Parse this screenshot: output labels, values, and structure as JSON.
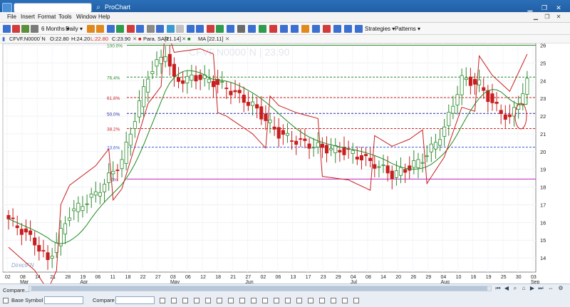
{
  "window": {
    "title": "ProChart",
    "search_value": ""
  },
  "menu": [
    "File",
    "Insert",
    "Format",
    "Tools",
    "Window",
    "Help"
  ],
  "toolbar": {
    "range": "6 Months",
    "interval": "Daily",
    "strategies": "Strategies",
    "patterns": "Patterns"
  },
  "quote": {
    "symbol": "CFVF.N0000`N",
    "open": "O:22.80",
    "high": "H:24.20",
    "low": "L:22.80",
    "close": "C:23.90"
  },
  "indicators": [
    {
      "label": "Para. SAR",
      "value": "[21.14]",
      "color": "#d42020"
    },
    {
      "label": "MA",
      "value": "[22.11]",
      "color": "#1e8a1e"
    }
  ],
  "watermark": "CFVF.N0000`N | 23.90",
  "brand_logo": "DirectFN",
  "fib_levels": [
    {
      "label": "100.0%",
      "price": 26.0,
      "color": "#2e8b2e"
    },
    {
      "label": "76.4%",
      "price": 24.2,
      "color": "#2a8a2a"
    },
    {
      "label": "61.8%",
      "price": 23.05,
      "color": "#d02020"
    },
    {
      "label": "50.0%",
      "price": 22.15,
      "color": "#2a2aa0"
    },
    {
      "label": "38.2%",
      "price": 21.3,
      "color": "#d02020"
    },
    {
      "label": "23.6%",
      "price": 20.25,
      "color": "#3a5fd0"
    },
    {
      "label": "0.0%",
      "price": 18.45,
      "color": "#c020c0"
    }
  ],
  "bottom": {
    "compare_label": "Compare...",
    "base_symbol_label": "Base Symbol",
    "compare_field_label": "Compare"
  },
  "chart_data": {
    "type": "candlestick",
    "y_ticks": [
      14,
      15,
      16,
      17,
      18,
      19,
      20,
      21,
      22,
      23,
      24,
      25,
      26
    ],
    "ylim": [
      13.2,
      26.1
    ],
    "x_ticks": [
      "02",
      "08",
      "14",
      "21",
      "28",
      "19",
      "06",
      "11",
      "18",
      "22",
      "27",
      "03",
      "06",
      "12",
      "18",
      "21",
      "27",
      "02",
      "06",
      "13",
      "17",
      "23",
      "29",
      "04",
      "08",
      "14",
      "20",
      "26",
      "29",
      "04",
      "10",
      "16",
      "19",
      "25",
      "30",
      "03"
    ],
    "month_labels": [
      "Mar",
      "Apr",
      "May",
      "Jun",
      "Jul",
      "Aug",
      "Sep"
    ],
    "last_close": 23.9,
    "ma_last": 22.11,
    "sar_last": 21.14
  }
}
